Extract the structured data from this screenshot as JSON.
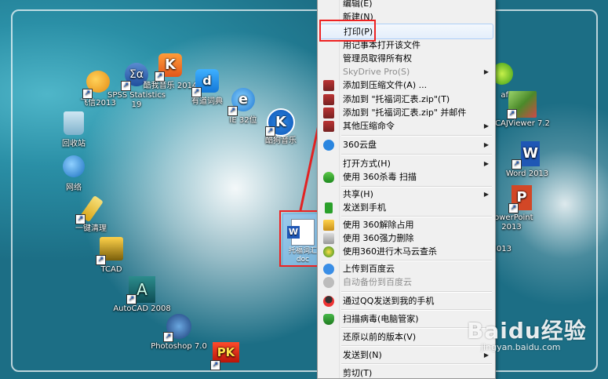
{
  "desktop": {
    "icons": [
      {
        "label": "回收站",
        "glyph": ""
      },
      {
        "label": "网络",
        "glyph": ""
      },
      {
        "label": "飞信2013",
        "glyph": ""
      },
      {
        "label": "SPSS Statistics 19",
        "glyph": "Σα"
      },
      {
        "label": "酷我音乐 2014",
        "glyph": "K"
      },
      {
        "label": "有道词典",
        "glyph": "d"
      },
      {
        "label": "IE 32位",
        "glyph": "e"
      },
      {
        "label": "酷狗音乐",
        "glyph": "K"
      },
      {
        "label": "一键清理",
        "glyph": ""
      },
      {
        "label": "TCAD",
        "glyph": ""
      },
      {
        "label": "AutoCAD 2008",
        "glyph": "A"
      },
      {
        "label": "Photoshop 7.0",
        "glyph": ""
      },
      {
        "label": "",
        "glyph": "PK"
      },
      {
        "label": "CAJViewer 7.2",
        "glyph": ""
      },
      {
        "label": "Word 2013",
        "glyph": "W"
      },
      {
        "label": "PowerPoint 2013",
        "glyph": "P"
      },
      {
        "label": "af",
        "glyph": ""
      },
      {
        "label": "2013",
        "glyph": ""
      }
    ],
    "selected_file": {
      "label_line1": "托福词汇",
      "label_line2": "doc",
      "glyph": "W"
    }
  },
  "menu": {
    "items": [
      {
        "label": "编辑(E)",
        "disabled": false,
        "submenu": false
      },
      {
        "label": "新建(N)",
        "disabled": false,
        "submenu": false
      },
      {
        "label": "打印(P)",
        "disabled": false,
        "submenu": false
      },
      {
        "label": "用记事本打开该文件",
        "disabled": false,
        "submenu": false
      },
      {
        "label": "管理员取得所有权",
        "disabled": false,
        "submenu": false
      },
      {
        "label": "SkyDrive Pro(S)",
        "disabled": true,
        "submenu": true
      },
      {
        "label": "添加到压缩文件(A) ...",
        "disabled": false,
        "submenu": false
      },
      {
        "label": "添加到 \"托福词汇表.zip\"(T)",
        "disabled": false,
        "submenu": false
      },
      {
        "label": "添加到 \"托福词汇表.zip\" 并邮件",
        "disabled": false,
        "submenu": false
      },
      {
        "label": "其他压缩命令",
        "disabled": false,
        "submenu": true
      },
      {
        "label": "360云盘",
        "disabled": false,
        "submenu": true
      },
      {
        "label": "打开方式(H)",
        "disabled": false,
        "submenu": true
      },
      {
        "label": "使用 360杀毒 扫描",
        "disabled": false,
        "submenu": false
      },
      {
        "label": "共享(H)",
        "disabled": false,
        "submenu": true
      },
      {
        "label": "发送到手机",
        "disabled": false,
        "submenu": false
      },
      {
        "label": "使用 360解除占用",
        "disabled": false,
        "submenu": false
      },
      {
        "label": "使用 360强力删除",
        "disabled": false,
        "submenu": false
      },
      {
        "label": "使用360进行木马云查杀",
        "disabled": false,
        "submenu": false
      },
      {
        "label": "上传到百度云",
        "disabled": false,
        "submenu": false
      },
      {
        "label": "自动备份到百度云",
        "disabled": true,
        "submenu": false
      },
      {
        "label": "通过QQ发送到我的手机",
        "disabled": false,
        "submenu": false
      },
      {
        "label": "扫描病毒(电脑管家)",
        "disabled": false,
        "submenu": false
      },
      {
        "label": "还原以前的版本(V)",
        "disabled": false,
        "submenu": false
      },
      {
        "label": "发送到(N)",
        "disabled": false,
        "submenu": true
      },
      {
        "label": "剪切(T)",
        "disabled": false,
        "submenu": false
      }
    ],
    "submenu_arrow": "▶"
  },
  "watermark": {
    "brand": "Baidu经验",
    "url": "jingyan.baidu.com"
  },
  "colors": {
    "annotation_red": "#e22222",
    "menu_bg": "#f0f0f0",
    "hover_border": "#aecff7"
  }
}
